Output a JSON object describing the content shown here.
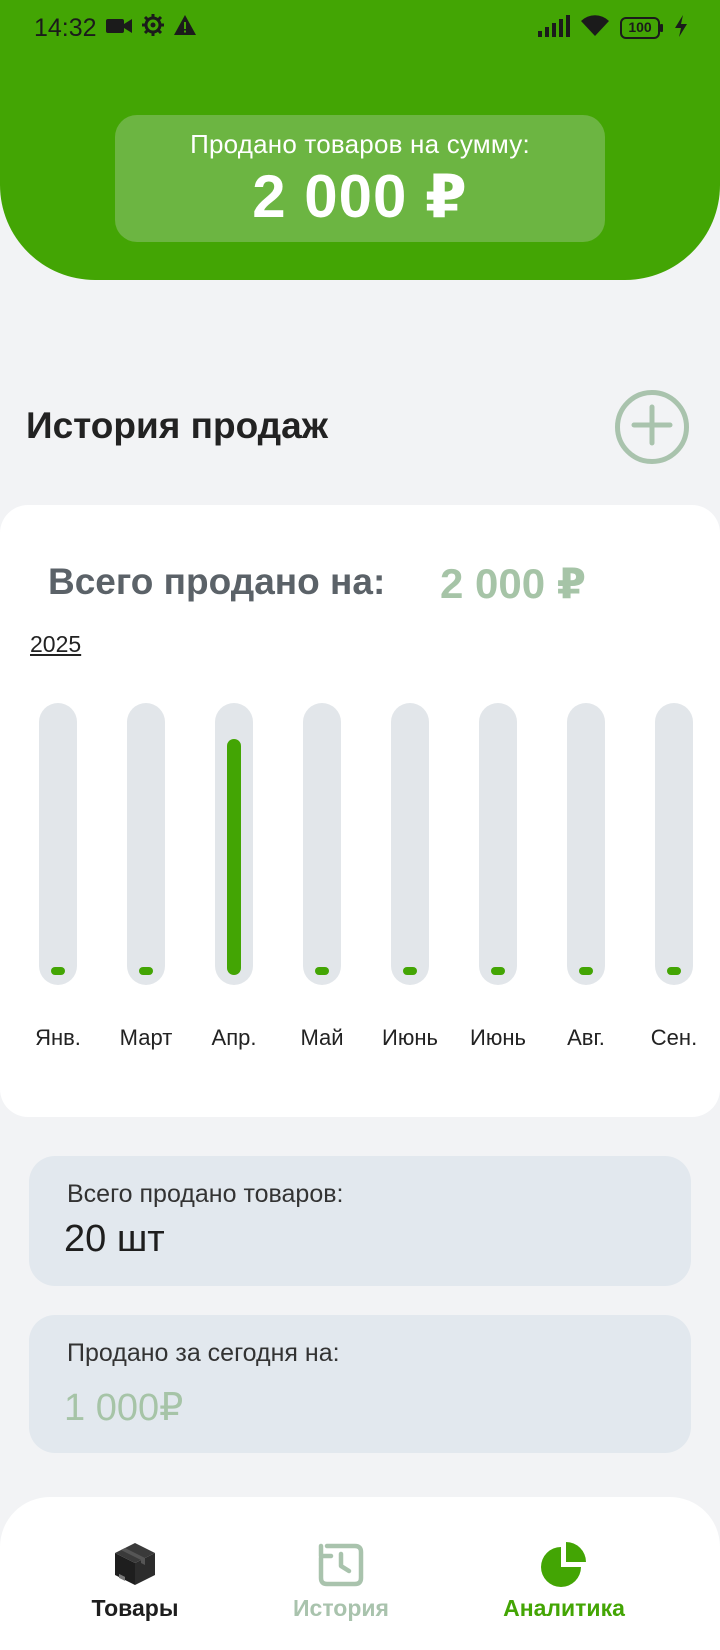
{
  "status_bar": {
    "time": "14:32",
    "battery": "100"
  },
  "header": {
    "sum_label": "Продано товаров на сумму:",
    "sum_value": "2 000 ₽"
  },
  "history": {
    "title": "История продаж"
  },
  "chart_card": {
    "total_label": "Всего продано на:",
    "total_value": "2 000 ₽",
    "year": "2025"
  },
  "chart_data": {
    "type": "bar",
    "categories": [
      "Янв.",
      "Март",
      "Апр.",
      "Май",
      "Июнь",
      "Июнь",
      "Авг.",
      "Сен."
    ],
    "values": [
      0,
      0,
      2000,
      0,
      0,
      0,
      0,
      0
    ],
    "ylim": [
      0,
      2000
    ],
    "title": "",
    "xlabel": "",
    "ylabel": "",
    "grid": false
  },
  "stats": {
    "total_items_label": "Всего продано товаров:",
    "total_items_value": "20 шт",
    "today_label": "Продано за сегодня на:",
    "today_value": "1 000₽"
  },
  "nav": {
    "goods": "Товары",
    "history": "История",
    "analytics": "Аналитика"
  },
  "colors": {
    "brand_green": "#43a504",
    "muted_green": "#a6c4a7",
    "card_gray": "#e2e8ee"
  },
  "icons": {
    "status": [
      "video-icon",
      "gear-icon",
      "warning-icon",
      "signal-icon",
      "wifi-icon",
      "battery-icon",
      "charging-icon"
    ],
    "add": "plus-circle-icon",
    "nav": [
      "box-icon",
      "history-clock-icon",
      "pie-chart-icon"
    ]
  }
}
